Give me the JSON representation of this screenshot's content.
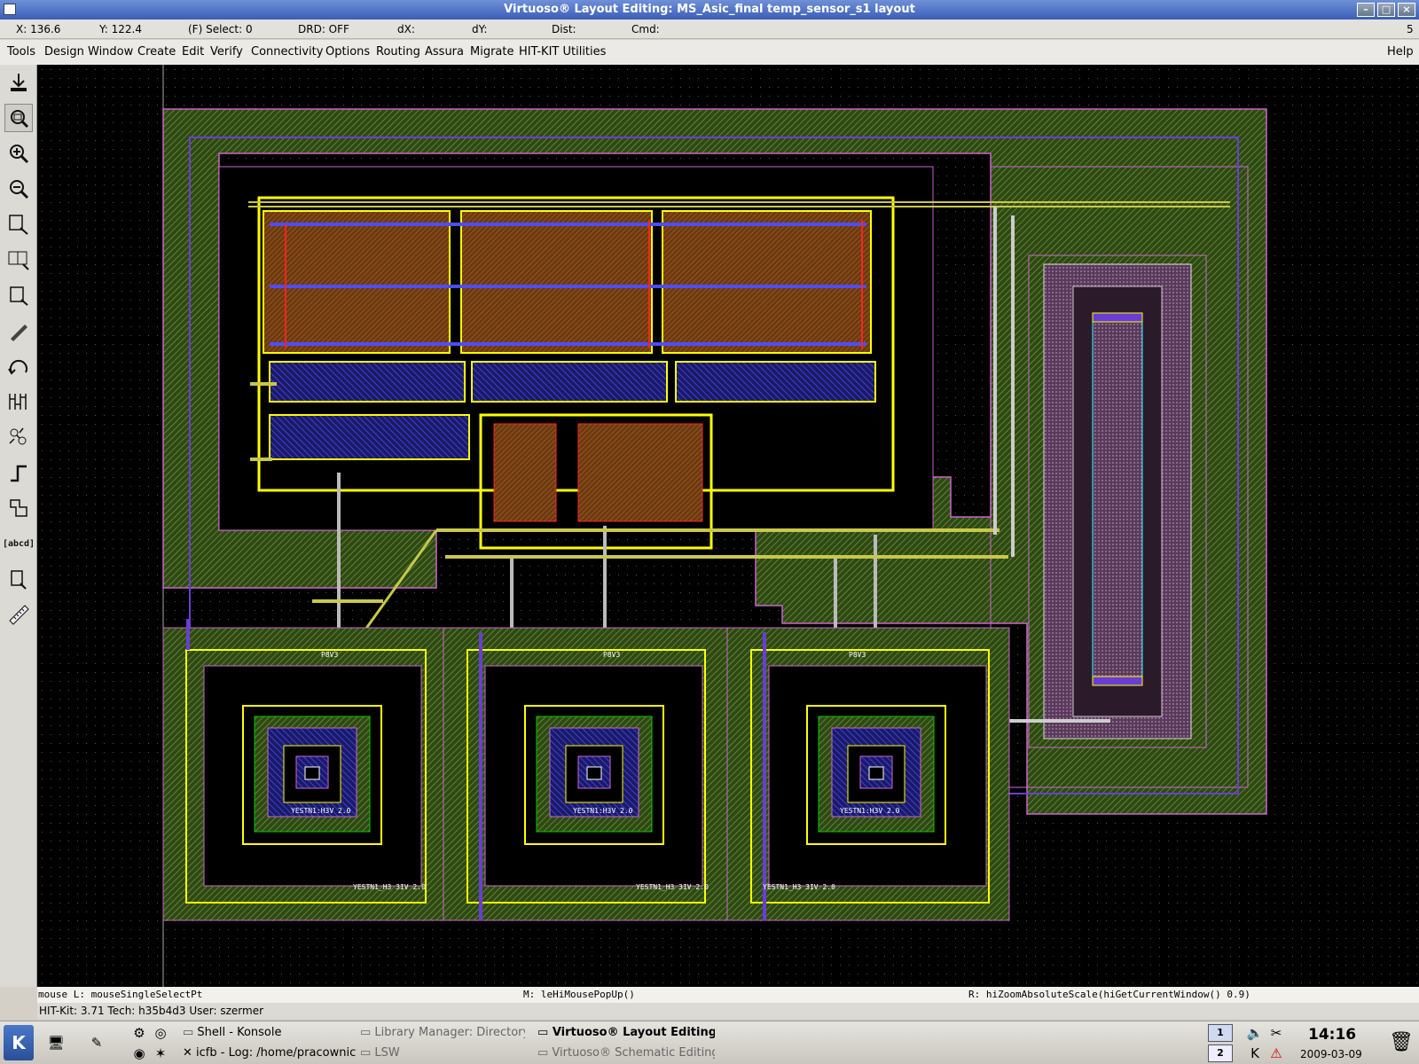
{
  "window": {
    "title": "Virtuoso® Layout Editing: MS_Asic_final temp_sensor_s1 layout",
    "corner_number": "5"
  },
  "status": {
    "x": "X:  136.6",
    "y": "Y:  122.4",
    "select": "(F) Select: 0",
    "drd": "DRD: OFF",
    "dx": "dX:",
    "dy": "dY:",
    "dist": "Dist:",
    "cmd": "Cmd:"
  },
  "menu": {
    "items": [
      "Tools",
      "Design",
      "Window",
      "Create",
      "Edit",
      "Verify",
      "Connectivity",
      "Options",
      "Routing",
      "Assura",
      "Migrate",
      "HIT-KIT Utilities"
    ],
    "help": "Help"
  },
  "toolbar": {
    "icons": [
      "save-icon",
      "fit-icon",
      "zoom-in-icon",
      "zoom-out-icon",
      "stretch-icon",
      "copy-icon",
      "move-icon",
      "delete-icon",
      "undo-icon",
      "property-icon",
      "instance-icon",
      "path-icon",
      "polygon-icon",
      "label-icon",
      "rectangle-icon",
      "ruler-icon"
    ],
    "label_text": "[abcd]"
  },
  "layout": {
    "transistor_labels": [
      "YESTN1:H3V 2.0",
      "YESTN1:H3V 2.0",
      "YESTN1:H3V 2.0"
    ],
    "guard_labels": [
      "YESTN1_H3 3IV 2.0",
      "YESTN1_H3 3IV 2.0",
      "YESTN1_H3 3IV 2.0"
    ],
    "pad_labels": [
      "P8V3",
      "P8V3",
      "P8V3"
    ]
  },
  "mouse": {
    "left": "mouse L: mouseSingleSelectPt",
    "middle": "M: leHiMousePopUp()",
    "right": "R: hiZoomAbsoluteScale(hiGetCurrentWindow() 0.9)"
  },
  "info": {
    "text": "HIT-Kit: 3.71  Tech: h35b4d3  User: szermer"
  },
  "taskbar": {
    "tasks": [
      "Shell - Konsole",
      "Library Manager: Directory ...",
      "Virtuoso® Layout Editing",
      "icfb - Log: /home/pracownicy",
      "LSW",
      "Virtuoso® Schematic Editing"
    ],
    "desktops": [
      "1",
      "2"
    ],
    "time": "14:16",
    "date": "2009-03-09"
  },
  "colors": {
    "canvas": "#000000",
    "metal1": "#3333ff",
    "metal2": "#ffff00",
    "poly": "#ff0000",
    "well": "#00aa00",
    "outline": "#cc66cc"
  }
}
